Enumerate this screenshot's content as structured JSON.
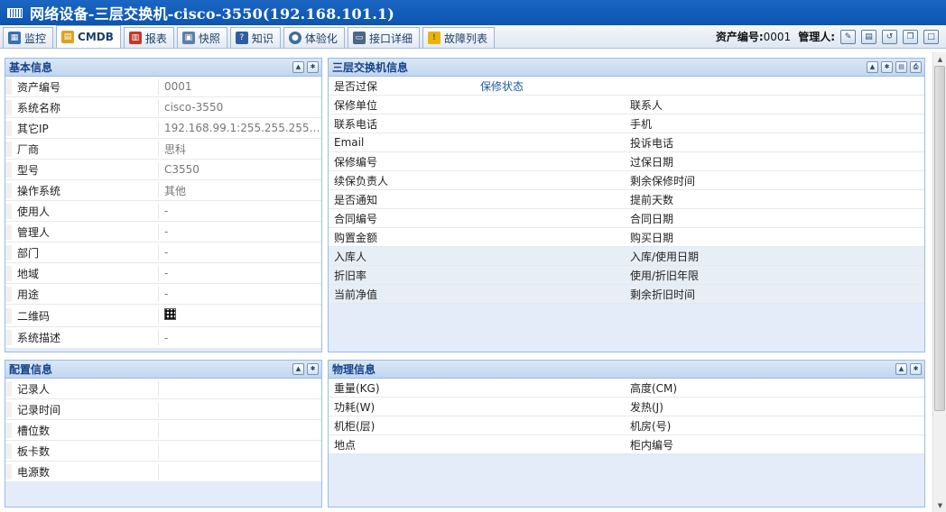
{
  "window": {
    "title": "网络设备-三层交换机-cisco-3550(192.168.101.1)"
  },
  "tabs": [
    {
      "label": "监控",
      "icon": "monitor-icon",
      "color": "#3a6fb0"
    },
    {
      "label": "CMDB",
      "icon": "cmdb-icon",
      "color": "#e0a020",
      "active": true
    },
    {
      "label": "报表",
      "icon": "report-icon",
      "color": "#c0392b"
    },
    {
      "label": "快照",
      "icon": "snapshot-icon",
      "color": "#5d7fa8"
    },
    {
      "label": "知识",
      "icon": "knowledge-icon",
      "color": "#2c5fa0"
    },
    {
      "label": "体验化",
      "icon": "experience-icon",
      "color": "#3c6d9e"
    },
    {
      "label": "接口详细",
      "icon": "interface-icon",
      "color": "#4a6888"
    },
    {
      "label": "故障列表",
      "icon": "warning-icon",
      "color": "#e8b400"
    }
  ],
  "header": {
    "asset_label": "资产编号:",
    "asset_value": "0001",
    "manager_label": "管理人:"
  },
  "basic": {
    "title": "基本信息",
    "rows": [
      {
        "label": "资产编号",
        "value": "0001"
      },
      {
        "label": "系统名称",
        "value": "cisco-3550"
      },
      {
        "label": "其它IP",
        "value": "192.168.99.1:255.255.255.0..."
      },
      {
        "label": "厂商",
        "value": "思科"
      },
      {
        "label": "型号",
        "value": "C3550"
      },
      {
        "label": "操作系统",
        "value": "其他"
      },
      {
        "label": "使用人",
        "value": "-"
      },
      {
        "label": "管理人",
        "value": "-"
      },
      {
        "label": "部门",
        "value": "-"
      },
      {
        "label": "地域",
        "value": "-"
      },
      {
        "label": "用途",
        "value": "-"
      },
      {
        "label": "二维码",
        "value": ""
      },
      {
        "label": "系统描述",
        "value": "-"
      }
    ]
  },
  "config": {
    "title": "配置信息",
    "rows": [
      {
        "label": "记录人",
        "value": ""
      },
      {
        "label": "记录时间",
        "value": ""
      },
      {
        "label": "槽位数",
        "value": ""
      },
      {
        "label": "板卡数",
        "value": ""
      },
      {
        "label": "电源数",
        "value": ""
      }
    ]
  },
  "switch_info": {
    "title": "三层交换机信息",
    "rows": [
      {
        "left": "是否过保",
        "right": "保修状态",
        "shade": false
      },
      {
        "left": "保修单位",
        "right": "联系人",
        "shade": false
      },
      {
        "left": "联系电话",
        "right": "手机",
        "shade": false
      },
      {
        "left": "Email",
        "right": "投诉电话",
        "shade": false
      },
      {
        "left": "保修编号",
        "right": "过保日期",
        "shade": false
      },
      {
        "left": "续保负责人",
        "right": "剩余保修时间",
        "shade": false
      },
      {
        "left": "是否通知",
        "right": "提前天数",
        "shade": false
      },
      {
        "left": "合同编号",
        "right": "合同日期",
        "shade": false
      },
      {
        "left": "购置金额",
        "right": "购买日期",
        "shade": false
      },
      {
        "left": "入库人",
        "right": "入库/使用日期",
        "shade": true
      },
      {
        "left": "折旧率",
        "right": "使用/折旧年限",
        "shade": true
      },
      {
        "left": "当前净值",
        "right": "剩余折旧时间",
        "shade": true
      }
    ]
  },
  "physical": {
    "title": "物理信息",
    "rows": [
      {
        "left": "重量(KG)",
        "right": "高度(CM)"
      },
      {
        "left": "功耗(W)",
        "right": "发热(J)"
      },
      {
        "left": "机柜(层)",
        "right": "机房(号)"
      },
      {
        "left": "地点",
        "right": "柜内编号"
      }
    ]
  },
  "colors": {
    "accent": "#15428b",
    "titlebar": "#1a66c2",
    "link": "#1a5a9a"
  }
}
